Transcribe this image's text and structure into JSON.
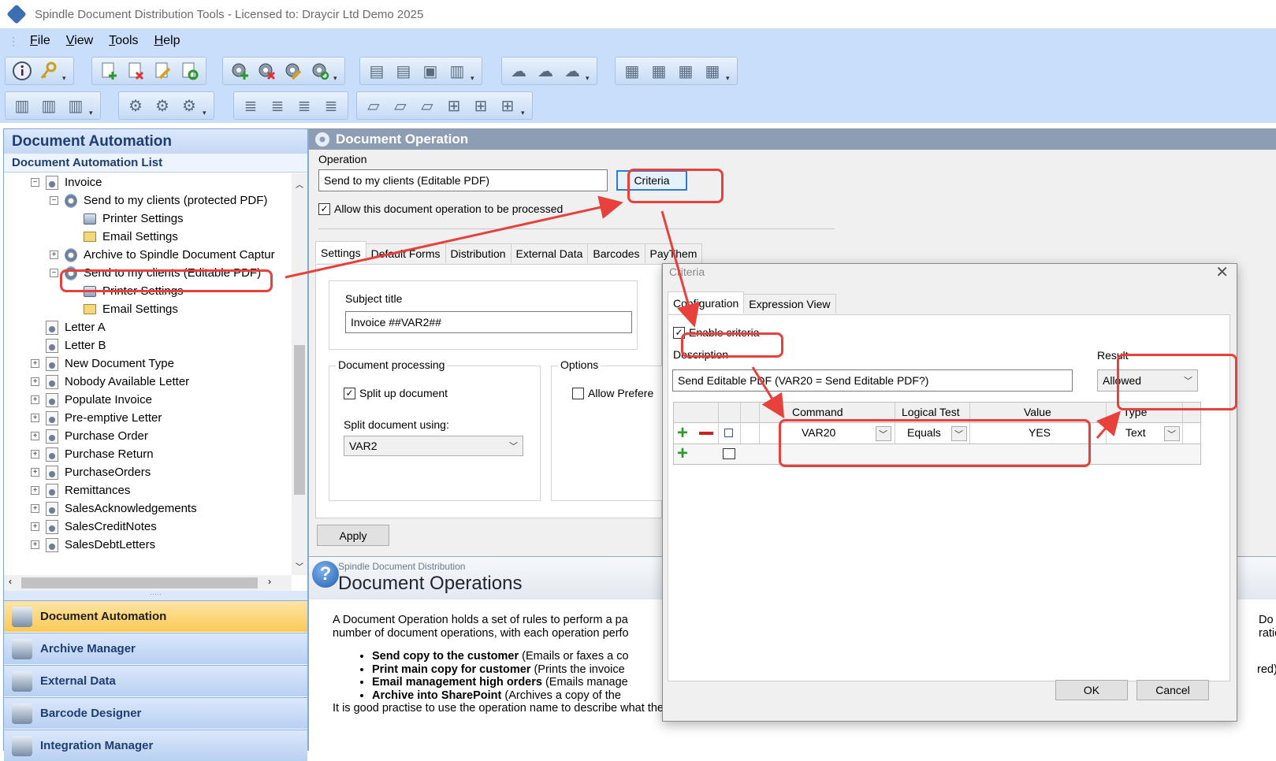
{
  "window": {
    "title": "Spindle Document Distribution Tools - Licensed to: Draycir Ltd Demo 2025"
  },
  "menu": [
    {
      "label": "File",
      "u": "F",
      "rest": "ile"
    },
    {
      "label": "View",
      "u": "V",
      "rest": "iew"
    },
    {
      "label": "Tools",
      "u": "T",
      "rest": "ools"
    },
    {
      "label": "Help",
      "u": "H",
      "rest": "elp"
    }
  ],
  "left": {
    "header": "Document Automation",
    "subheader": "Document Automation List",
    "tree": [
      {
        "label": "Invoice",
        "level": 0,
        "icon": "doc-gear-icon",
        "expander": "⊟"
      },
      {
        "label": "Send to my clients (protected PDF)",
        "level": 1,
        "icon": "gear-icon",
        "expander": "⊟"
      },
      {
        "label": "Printer Settings",
        "level": 2,
        "icon": "printer-icon",
        "expander": ""
      },
      {
        "label": "Email Settings",
        "level": 2,
        "icon": "mail-icon",
        "expander": ""
      },
      {
        "label": "Archive to Spindle Document Captur",
        "level": 1,
        "icon": "gear-icon",
        "expander": "⊞"
      },
      {
        "label": "Send to my clients (Editable PDF)",
        "level": 1,
        "icon": "gear-icon",
        "expander": "⊟"
      },
      {
        "label": "Printer Settings",
        "level": 2,
        "icon": "printer-icon",
        "expander": ""
      },
      {
        "label": "Email Settings",
        "level": 2,
        "icon": "mail-icon",
        "expander": ""
      },
      {
        "label": "Letter A",
        "level": 0,
        "icon": "doc-gear-icon",
        "expander": ""
      },
      {
        "label": "Letter B",
        "level": 0,
        "icon": "doc-gear-icon",
        "expander": ""
      },
      {
        "label": "New Document Type",
        "level": 0,
        "icon": "doc-gear-icon",
        "expander": "⊞"
      },
      {
        "label": "Nobody Available Letter",
        "level": 0,
        "icon": "doc-gear-icon",
        "expander": "⊞"
      },
      {
        "label": "Populate Invoice",
        "level": 0,
        "icon": "doc-gear-icon",
        "expander": "⊞"
      },
      {
        "label": "Pre-emptive Letter",
        "level": 0,
        "icon": "doc-gear-icon",
        "expander": "⊞"
      },
      {
        "label": "Purchase Order",
        "level": 0,
        "icon": "doc-gear-icon",
        "expander": "⊞"
      },
      {
        "label": "Purchase Return",
        "level": 0,
        "icon": "doc-gear-icon",
        "expander": "⊞"
      },
      {
        "label": "PurchaseOrders",
        "level": 0,
        "icon": "doc-gear-icon",
        "expander": "⊞"
      },
      {
        "label": "Remittances",
        "level": 0,
        "icon": "doc-gear-icon",
        "expander": "⊞"
      },
      {
        "label": "SalesAcknowledgements",
        "level": 0,
        "icon": "doc-gear-icon",
        "expander": "⊞"
      },
      {
        "label": "SalesCreditNotes",
        "level": 0,
        "icon": "doc-gear-icon",
        "expander": "⊞"
      },
      {
        "label": "SalesDebtLetters",
        "level": 0,
        "icon": "doc-gear-icon",
        "expander": "⊞"
      }
    ],
    "nav": [
      {
        "label": "Document Automation",
        "active": true
      },
      {
        "label": "Archive Manager",
        "active": false
      },
      {
        "label": "External Data",
        "active": false
      },
      {
        "label": "Barcode Designer",
        "active": false
      },
      {
        "label": "Integration Manager",
        "active": false
      }
    ]
  },
  "right": {
    "header": "Document Operation",
    "operation_label": "Operation",
    "operation_value": "Send to my clients (Editable PDF)",
    "criteria_button": "Criteria",
    "allow_checkbox": "Allow this document operation to be processed",
    "tabs": [
      "Settings",
      "Default Forms",
      "Distribution",
      "External Data",
      "Barcodes",
      "PayThem"
    ],
    "subject_label": "Subject title",
    "subject_value": "Invoice ##VAR2##",
    "doc_processing_title": "Document processing",
    "split_up_label": "Split up document",
    "split_using_label": "Split document using:",
    "split_using_value": "VAR2",
    "options_title": "Options",
    "allow_pref_label": "Allow Prefere",
    "apply_button": "Apply"
  },
  "help": {
    "small_title": "Spindle Document Distribution",
    "title": "Document Operations",
    "intro1": "A Document Operation holds a set of rules to perform a pa",
    "intro2": "number of document operations, with each operation perfo",
    "intro_right1": "Do",
    "intro_right2": "ratic",
    "bullets": [
      {
        "bold": "Send copy to the customer",
        "rest": " (Emails or faxes a co"
      },
      {
        "bold": "Print main copy for customer",
        "rest": " (Prints the invoice"
      },
      {
        "bold": "Email management high orders",
        "rest": " (Emails manage"
      },
      {
        "bold": "Archive into SharePoint",
        "rest": " (Archives a copy of the"
      }
    ],
    "right_edge": "red)",
    "footer": "It is good practise to use the operation name to describe what the operation is intended to achieve. E.g. \"Send a copy to my customers\", \"Email the warehouse manager"
  },
  "dialog": {
    "title": "Criteria",
    "close": "✕",
    "tabs": [
      "Configuration",
      "Expression View"
    ],
    "enable_label": "Enable criteria",
    "description_label": "Description",
    "description_value": "Send Editable PDF (VAR20 = Send Editable PDF?)",
    "result_label": "Result",
    "result_value": "Allowed",
    "grid_headers": [
      "Command",
      "Logical Test",
      "Value",
      "Type"
    ],
    "row": {
      "command": "VAR20",
      "test": "Equals",
      "value": "YES",
      "type": "Text"
    },
    "ok": "OK",
    "cancel": "Cancel"
  },
  "colors": {
    "annotation_red": "#e8413b",
    "menu_bg": "#c9defa",
    "active_nav": "#fbc955"
  }
}
